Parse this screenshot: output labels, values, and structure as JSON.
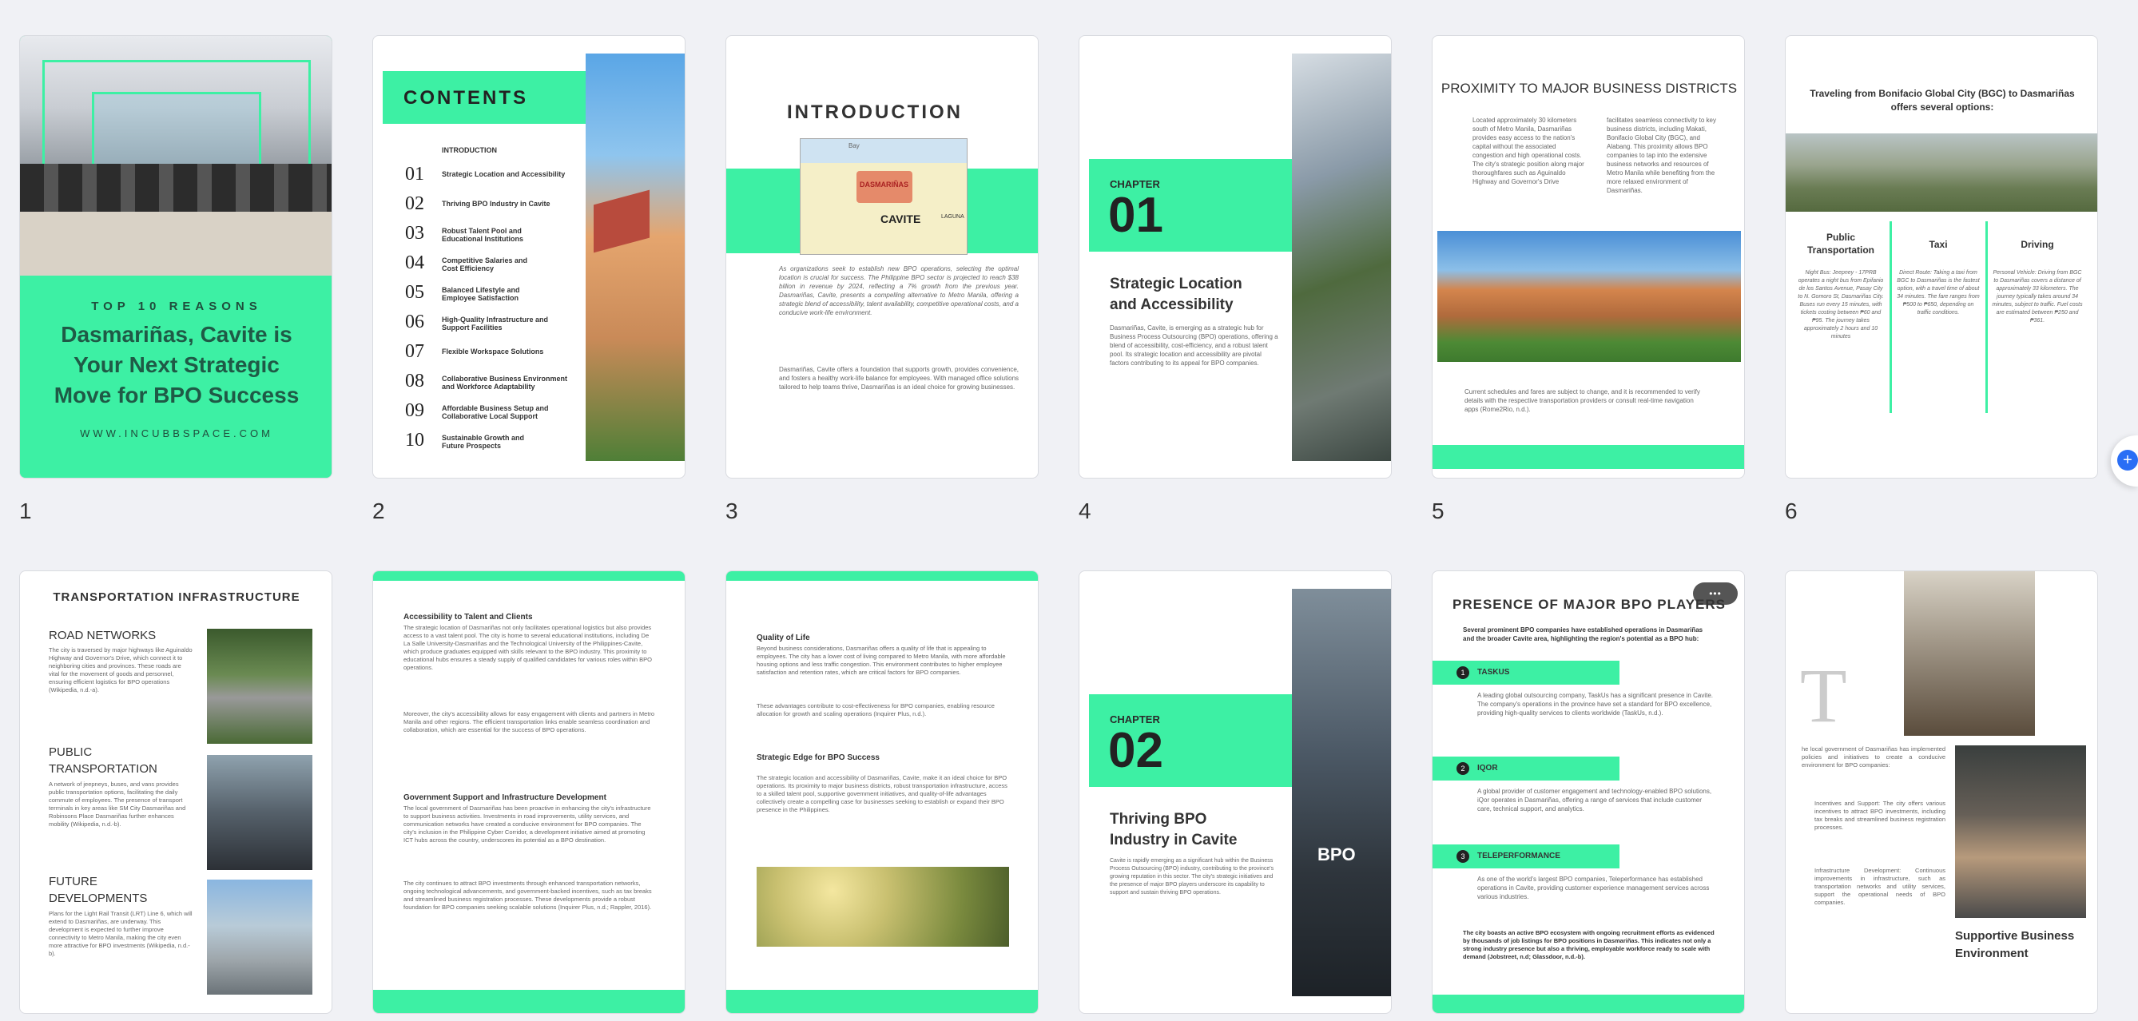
{
  "brand_color": "#3df0a4",
  "page_numbers": [
    "1",
    "2",
    "3",
    "4",
    "5",
    "6"
  ],
  "p1": {
    "kicker": "TOP 10 REASONS",
    "title": "Dasmariñas, Cavite is Your Next Strategic Move for BPO Success",
    "url": "WWW.INCUBBSPACE.COM"
  },
  "p2": {
    "title": "CONTENTS",
    "intro": "INTRODUCTION",
    "items": [
      {
        "n": "01",
        "t": "Strategic Location and Accessibility"
      },
      {
        "n": "02",
        "t": "Thriving BPO Industry in Cavite"
      },
      {
        "n": "03",
        "t": "Robust Talent Pool and Educational Institutions"
      },
      {
        "n": "04",
        "t": "Competitive Salaries and Cost Efficiency"
      },
      {
        "n": "05",
        "t": "Balanced Lifestyle and Employee Satisfaction"
      },
      {
        "n": "06",
        "t": "High-Quality Infrastructure and Support Facilities"
      },
      {
        "n": "07",
        "t": "Flexible Workspace Solutions"
      },
      {
        "n": "08",
        "t": "Collaborative Business Environment and Workforce Adaptability"
      },
      {
        "n": "09",
        "t": "Affordable Business Setup and Collaborative Local Support"
      },
      {
        "n": "10",
        "t": "Sustainable Growth and Future Prospects"
      }
    ]
  },
  "p3": {
    "title": "INTRODUCTION",
    "map_labels": {
      "bay": "Bay",
      "dasma": "DASMARIÑAS",
      "cavite": "CAVITE",
      "laguna": "LAGUNA"
    },
    "para1": "As organizations seek to establish new BPO operations, selecting the optimal location is crucial for success. The Philippine BPO sector is projected to reach $38 billion in revenue by 2024, reflecting a 7% growth from the previous year. Dasmariñas, Cavite, presents a compelling alternative to Metro Manila, offering a strategic blend of accessibility, talent availability, competitive operational costs, and a conducive work-life environment.",
    "para2": "Dasmariñas, Cavite offers a foundation that supports growth, provides convenience, and fosters a healthy work-life balance for employees. With managed office solutions tailored to help teams thrive, Dasmariñas is an ideal choice for growing businesses."
  },
  "p4": {
    "chapter": "CHAPTER",
    "num": "01",
    "title": "Strategic Location and Accessibility",
    "body": "Dasmariñas, Cavite, is emerging as a strategic hub for Business Process Outsourcing (BPO) operations, offering a blend of accessibility, cost-efficiency, and a robust talent pool. Its strategic location and accessibility are pivotal factors contributing to its appeal for BPO companies."
  },
  "p5": {
    "title": "PROXIMITY TO MAJOR BUSINESS DISTRICTS",
    "col1": "Located approximately 30 kilometers south of Metro Manila, Dasmariñas provides easy access to the nation's capital without the associated congestion and high operational costs. The city's strategic position along major thoroughfares such as Aguinaldo Highway and Governor's Drive",
    "col2": "facilitates seamless connectivity to key business districts, including Makati, Bonifacio Global City (BGC), and Alabang. This proximity allows BPO companies to tap into the extensive business networks and resources of Metro Manila while benefiting from the more relaxed environment of Dasmariñas.",
    "note": "Current schedules and fares are subject to change, and it is recommended to verify details with the respective transportation providers or consult real-time navigation apps (Rome2Rio, n.d.)."
  },
  "p6": {
    "title": "Traveling from Bonifacio Global City (BGC) to Dasmariñas offers several options:",
    "cols": [
      {
        "h": "Public Transportation",
        "t": "Night Bus: Jeepney - 17PRB operates a night bus from Epifanio de los Santos Avenue, Pasay City to N. Gomoro St, Dasmariñas City. Buses run every 15 minutes, with tickets costing between ₱60 and ₱95. The journey takes approximately 2 hours and 10 minutes"
      },
      {
        "h": "Taxi",
        "t": "Direct Route: Taking a taxi from BGC to Dasmariñas is the fastest option, with a travel time of about 34 minutes. The fare ranges from ₱500 to ₱650, depending on traffic conditions."
      },
      {
        "h": "Driving",
        "t": "Personal Vehicle: Driving from BGC to Dasmariñas covers a distance of approximately 33 kilometers. The journey typically takes around 34 minutes, subject to traffic. Fuel costs are estimated between ₱250 and ₱361."
      }
    ]
  },
  "p7": {
    "title": "TRANSPORTATION INFRASTRUCTURE",
    "sections": [
      {
        "h": "ROAD NETWORKS",
        "t": "The city is traversed by major highways like Aguinaldo Highway and Governor's Drive, which connect it to neighboring cities and provinces. These roads are vital for the movement of goods and personnel, ensuring efficient logistics for BPO operations (Wikipedia, n.d.-a)."
      },
      {
        "h": "PUBLIC TRANSPORTATION",
        "t": "A network of jeepneys, buses, and vans provides public transportation options, facilitating the daily commute of employees. The presence of transport terminals in key areas like SM City Dasmariñas and Robinsons Place Dasmariñas further enhances mobility (Wikipedia, n.d.-b)."
      },
      {
        "h": "FUTURE DEVELOPMENTS",
        "t": "Plans for the Light Rail Transit (LRT) Line 6, which will extend to Dasmariñas, are underway. This development is expected to further improve connectivity to Metro Manila, making the city even more attractive for BPO investments (Wikipedia, n.d.-b)."
      }
    ]
  },
  "p8": {
    "h1": "Accessibility to Talent and Clients",
    "t1": "The strategic location of Dasmariñas not only facilitates operational logistics but also provides access to a vast talent pool. The city is home to several educational institutions, including De La Salle University-Dasmariñas and the Technological University of the Philippines-Cavite, which produce graduates equipped with skills relevant to the BPO industry. This proximity to educational hubs ensures a steady supply of qualified candidates for various roles within BPO operations.",
    "t2": "Moreover, the city's accessibility allows for easy engagement with clients and partners in Metro Manila and other regions. The efficient transportation links enable seamless coordination and collaboration, which are essential for the success of BPO operations.",
    "h2": "Government Support and Infrastructure Development",
    "t3": "The local government of Dasmariñas has been proactive in enhancing the city's infrastructure to support business activities. Investments in road improvements, utility services, and communication networks have created a conducive environment for BPO companies. The city's inclusion in the Philippine Cyber Corridor, a development initiative aimed at promoting ICT hubs across the country, underscores its potential as a BPO destination.",
    "t4": "The city continues to attract BPO investments through enhanced transportation networks, ongoing technological advancements, and government-backed incentives, such as tax breaks and streamlined business registration processes. These developments provide a robust foundation for BPO companies seeking scalable solutions (Inquirer Plus, n.d.; Rappler, 2016)."
  },
  "p9": {
    "h1": "Quality of Life",
    "t1": "Beyond business considerations, Dasmariñas offers a quality of life that is appealing to employees. The city has a lower cost of living compared to Metro Manila, with more affordable housing options and less traffic congestion. This environment contributes to higher employee satisfaction and retention rates, which are critical factors for BPO companies.",
    "t2": "These advantages contribute to cost-effectiveness for BPO companies, enabling resource allocation for growth and scaling operations (Inquirer Plus, n.d.).",
    "h2": "Strategic Edge for BPO Success",
    "t3": "The strategic location and accessibility of Dasmariñas, Cavite, make it an ideal choice for BPO operations. Its proximity to major business districts, robust transportation infrastructure, access to a skilled talent pool, supportive government initiatives, and quality-of-life advantages collectively create a compelling case for businesses seeking to establish or expand their BPO presence in the Philippines."
  },
  "p10": {
    "chapter": "CHAPTER",
    "num": "02",
    "title": "Thriving BPO Industry in Cavite",
    "body": "Cavite is rapidly emerging as a significant hub within the Business Process Outsourcing (BPO) industry, contributing to the province's growing reputation in this sector. The city's strategic initiatives and the presence of major BPO players underscore its capability to support and sustain thriving BPO operations.",
    "sign": "BPO"
  },
  "p11": {
    "title": "PRESENCE OF MAJOR BPO PLAYERS",
    "intro": "Several prominent BPO companies have established operations in Dasmariñas and the broader Cavite area, highlighting the region's potential as a BPO hub:",
    "companies": [
      {
        "n": "1",
        "name": "TASKUS",
        "t": "A leading global outsourcing company, TaskUs has a significant presence in Cavite. The company's operations in the province have set a standard for BPO excellence, providing high-quality services to clients worldwide (TaskUs, n.d.)."
      },
      {
        "n": "2",
        "name": "IQOR",
        "t": "A global provider of customer engagement and technology-enabled BPO solutions, iQor operates in Dasmariñas, offering a range of services that include customer care, technical support, and analytics."
      },
      {
        "n": "3",
        "name": "TELEPERFORMANCE",
        "t": "As one of the world's largest BPO companies, Teleperformance has established operations in Cavite, providing customer experience management services across various industries."
      }
    ],
    "closing": "The city boasts an active BPO ecosystem with ongoing recruitment efforts as evidenced by thousands of job listings for BPO positions in Dasmariñas. This indicates not only a strong industry presence but also a thriving, employable workforce ready to scale with demand (Jobstreet, n.d; Glassdoor, n.d.-b).",
    "menu": "•••"
  },
  "p12": {
    "dropcap": "T",
    "lead": "he local government of Dasmariñas has implemented policies and initiatives to create a conducive environment for BPO companies:",
    "bullets": [
      "Incentives and Support: The city offers various incentives to attract BPO investments, including tax breaks and streamlined business registration processes.",
      "Infrastructure Development: Continuous improvements in infrastructure, such as transportation networks and utility services, support the operational needs of BPO companies."
    ],
    "caption": "Supportive Business Environment"
  }
}
